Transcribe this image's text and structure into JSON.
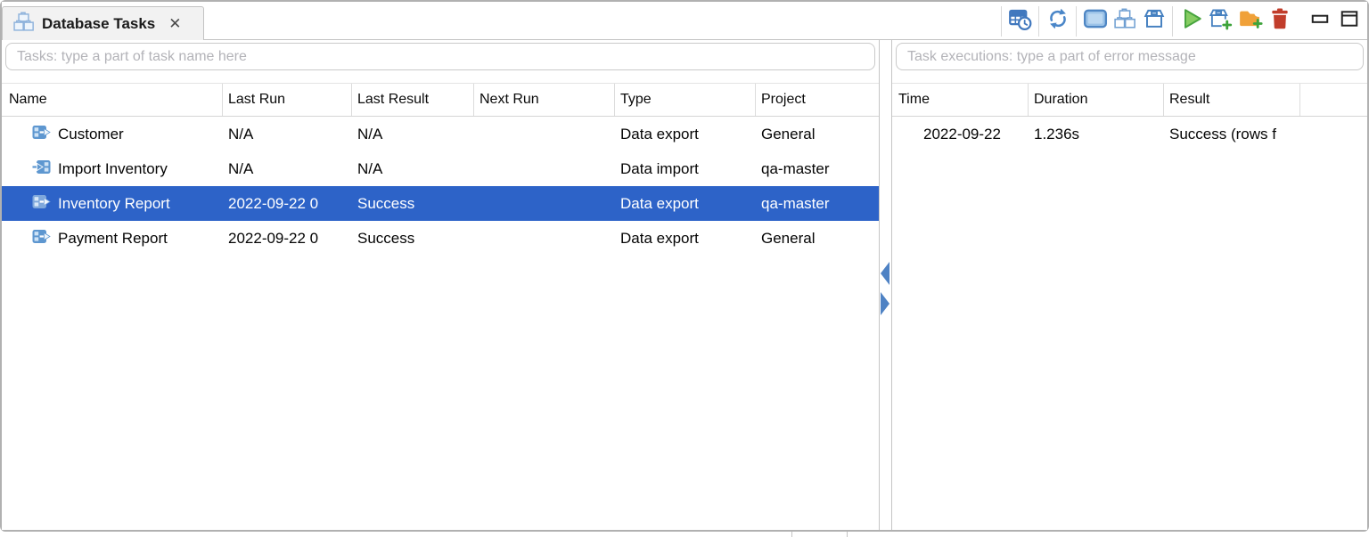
{
  "tab": {
    "title": "Database Tasks",
    "close_glyph": "✕"
  },
  "toolbar": {
    "buttons": [
      {
        "id": "view-task-schedules",
        "icon": "table-clock-icon"
      },
      {
        "id": "refresh",
        "icon": "refresh-icon"
      },
      {
        "id": "show-panel",
        "icon": "panel-icon"
      },
      {
        "id": "group-tasks",
        "icon": "boxes-icon"
      },
      {
        "id": "flat-view",
        "icon": "open-box-icon"
      },
      {
        "id": "run-task",
        "icon": "play-icon"
      },
      {
        "id": "create-new-task",
        "icon": "new-task-icon"
      },
      {
        "id": "create-task-folder",
        "icon": "new-folder-icon"
      },
      {
        "id": "delete-task",
        "icon": "trash-icon"
      },
      {
        "id": "minimize",
        "icon": "minimize-icon"
      },
      {
        "id": "maximize",
        "icon": "maximize-icon"
      }
    ]
  },
  "tasks_panel": {
    "filter_placeholder": "Tasks: type a part of task name here",
    "columns": [
      "Name",
      "Last Run",
      "Last Result",
      "Next Run",
      "Type",
      "Project"
    ],
    "rows": [
      {
        "name": "Customer",
        "icon": "data-export-icon",
        "last_run": "N/A",
        "last_result": "N/A",
        "next_run": "",
        "type": "Data export",
        "project": "General",
        "selected": false
      },
      {
        "name": "Import Inventory",
        "icon": "data-import-icon",
        "last_run": "N/A",
        "last_result": "N/A",
        "next_run": "",
        "type": "Data import",
        "project": "qa-master",
        "selected": false
      },
      {
        "name": "Inventory Report",
        "icon": "data-export-icon",
        "last_run": "2022-09-22 0",
        "last_result": "Success",
        "next_run": "",
        "type": "Data export",
        "project": "qa-master",
        "selected": true
      },
      {
        "name": "Payment Report",
        "icon": "data-export-icon",
        "last_run": "2022-09-22 0",
        "last_result": "Success",
        "next_run": "",
        "type": "Data export",
        "project": "General",
        "selected": false
      }
    ]
  },
  "executions_panel": {
    "filter_placeholder": "Task executions: type a part of error message",
    "columns": [
      "Time",
      "Duration",
      "Result"
    ],
    "rows": [
      {
        "time": "2022-09-22",
        "duration": "1.236s",
        "result": "Success (rows f"
      }
    ]
  },
  "colors": {
    "selection_bg": "#2D63C8",
    "selection_text": "#FFFFFF",
    "icon_blue": "#4580C0",
    "play_green": "#86CD62",
    "folder_orange": "#F0A139",
    "trash_red": "#C13D2B"
  }
}
